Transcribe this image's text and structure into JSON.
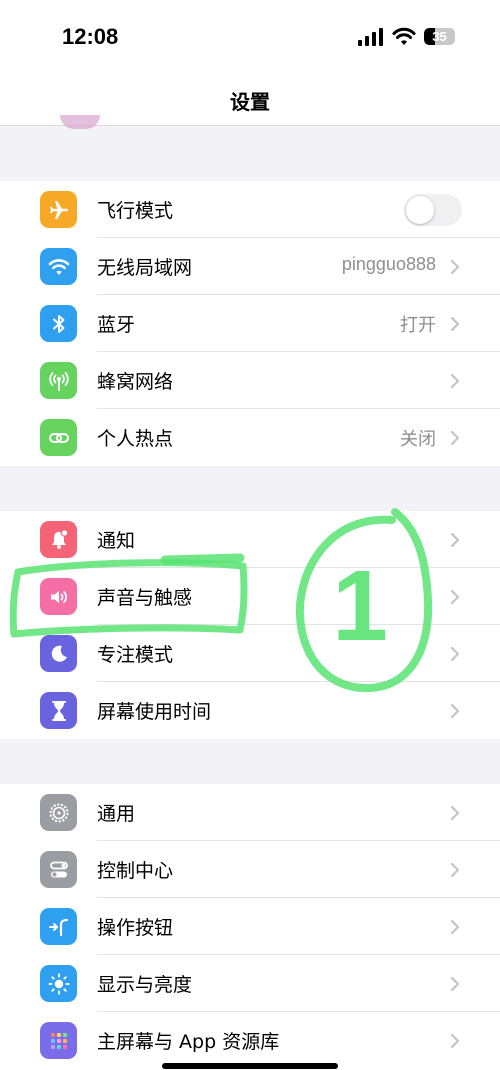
{
  "status": {
    "time": "12:08",
    "battery": "35",
    "battery_level": 35
  },
  "nav": {
    "title": "设置"
  },
  "colors": {
    "airplane": "#f8a827",
    "wifi": "#2f9ff0",
    "bluetooth": "#2f9ff0",
    "cellular": "#66d35f",
    "hotspot": "#66d35f",
    "notifications": "#f56376",
    "sounds": "#f56ea6",
    "focus": "#6a63df",
    "screen_time": "#6a63df",
    "general": "#9c9ca3",
    "control_center": "#9c9ca3",
    "action_button": "#2f9ff0",
    "display": "#2f9ff0",
    "home_screen": "#6a63df",
    "annotation": "#59e373"
  },
  "groups": {
    "connectivity": [
      {
        "label": "飞行模式",
        "icon": "airplane-icon",
        "toggle_on": false
      },
      {
        "label": "无线局域网",
        "icon": "wifi-icon",
        "value": "pingguo888"
      },
      {
        "label": "蓝牙",
        "icon": "bluetooth-icon",
        "value": "打开"
      },
      {
        "label": "蜂窝网络",
        "icon": "antenna-icon"
      },
      {
        "label": "个人热点",
        "icon": "link-icon",
        "value": "关闭"
      }
    ],
    "alerts": [
      {
        "label": "通知",
        "icon": "bell-icon"
      },
      {
        "label": "声音与触感",
        "icon": "speaker-icon"
      },
      {
        "label": "专注模式",
        "icon": "moon-icon"
      },
      {
        "label": "屏幕使用时间",
        "icon": "hourglass-icon"
      }
    ],
    "system": [
      {
        "label": "通用",
        "icon": "gear-icon"
      },
      {
        "label": "控制中心",
        "icon": "switches-icon"
      },
      {
        "label": "操作按钮",
        "icon": "action-button-icon"
      },
      {
        "label": "显示与亮度",
        "icon": "sun-icon"
      },
      {
        "label": "主屏幕与 App 资源库",
        "icon": "app-grid-icon"
      }
    ]
  },
  "annotation": {
    "text": "1"
  }
}
